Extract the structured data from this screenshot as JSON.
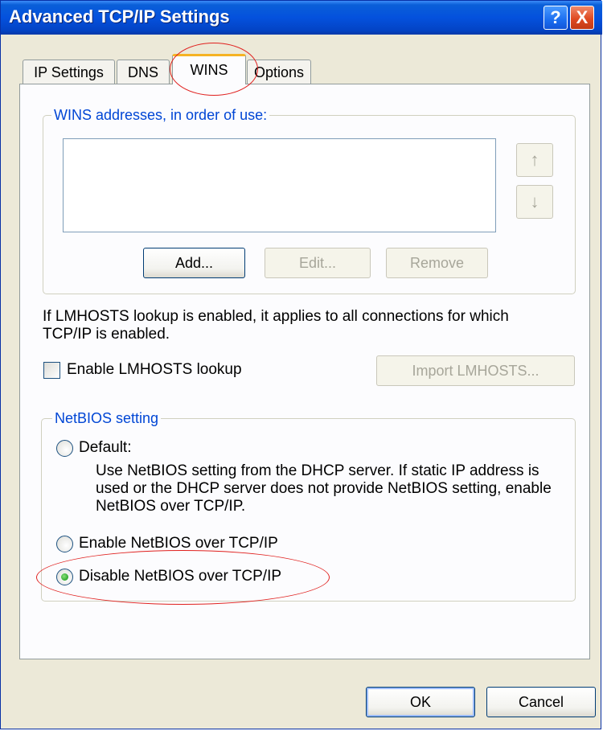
{
  "window": {
    "title": "Advanced TCP/IP Settings",
    "help_glyph": "?",
    "close_glyph": "X"
  },
  "tabs": [
    {
      "label": "IP Settings",
      "active": false
    },
    {
      "label": "DNS",
      "active": false
    },
    {
      "label": "WINS",
      "active": true
    },
    {
      "label": "Options",
      "active": false
    }
  ],
  "wins": {
    "group_label": "WINS addresses, in order of use:",
    "list_items": [],
    "up_arrow": "↑",
    "down_arrow": "↓",
    "add_label": "Add...",
    "edit_label": "Edit...",
    "remove_label": "Remove"
  },
  "lmhosts": {
    "info_text": "If LMHOSTS lookup is enabled, it applies to all connections for which TCP/IP is enabled.",
    "checkbox_label": "Enable LMHOSTS lookup",
    "checked": false,
    "import_label": "Import LMHOSTS..."
  },
  "netbios": {
    "group_label": "NetBIOS setting",
    "selected": "disable",
    "default_label": "Default:",
    "default_description": "Use NetBIOS setting from the DHCP server. If static IP address is used or the DHCP server does not provide NetBIOS setting, enable NetBIOS over TCP/IP.",
    "enable_label": "Enable NetBIOS over TCP/IP",
    "disable_label": "Disable NetBIOS over TCP/IP"
  },
  "footer": {
    "ok_label": "OK",
    "cancel_label": "Cancel"
  },
  "colors": {
    "titlebar": "#0451dd",
    "group_label": "#0046d5",
    "annotation": "#e0201e",
    "tab_highlight": "#f5b324"
  }
}
